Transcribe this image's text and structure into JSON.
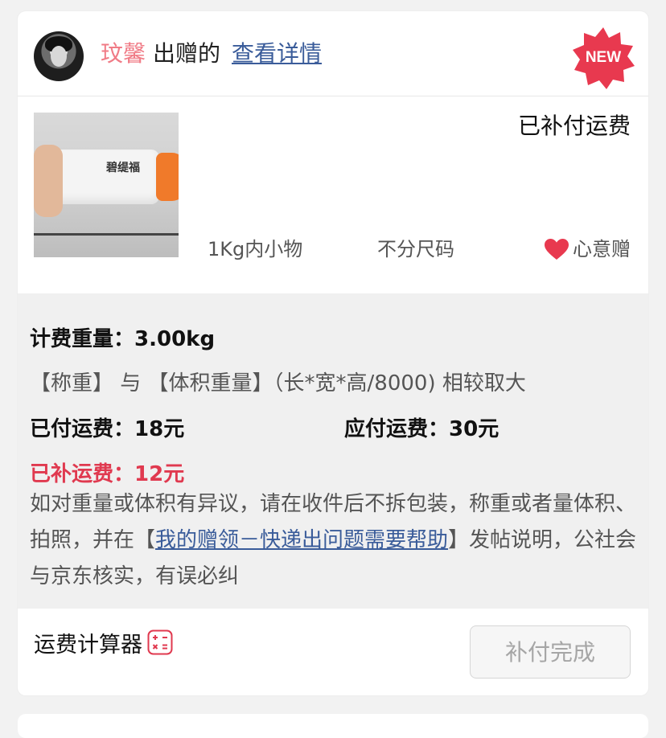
{
  "header": {
    "donor_name": "玟馨",
    "gave_text": "出赠的",
    "detail_link": "查看详情",
    "new_badge": "NEW"
  },
  "product": {
    "status": "已补付运费",
    "weight_class": "1Kg内小物",
    "size": "不分尺码",
    "gift_type": "心意赠",
    "photo_label": "碧缇福"
  },
  "shipping": {
    "billing_weight_label": "计费重量：",
    "billing_weight_value": "3.00kg",
    "rule_text": "【称重】 与 【体积重量】（长*宽*高/8000) 相较取大",
    "paid_label": "已付运费：",
    "paid_value": "18元",
    "due_label": "应付运费：",
    "due_value": "30元",
    "supplement_label": "已补运费：",
    "supplement_value": "12元",
    "note_before": "如对重量或体积有异议，请在收件后不拆包装，称重或者量体积、拍照，并在【",
    "note_link": "我的赠领－快递出问题需要帮助",
    "note_after": "】发帖说明，公社会与京东核实，有误必纠"
  },
  "footer": {
    "calculator_label": "运费计算器",
    "complete_button": "补付完成"
  },
  "colors": {
    "donor": "#f07b86",
    "link": "#3a5c9a",
    "accent_red": "#e0394f",
    "badge": "#e8394f"
  }
}
